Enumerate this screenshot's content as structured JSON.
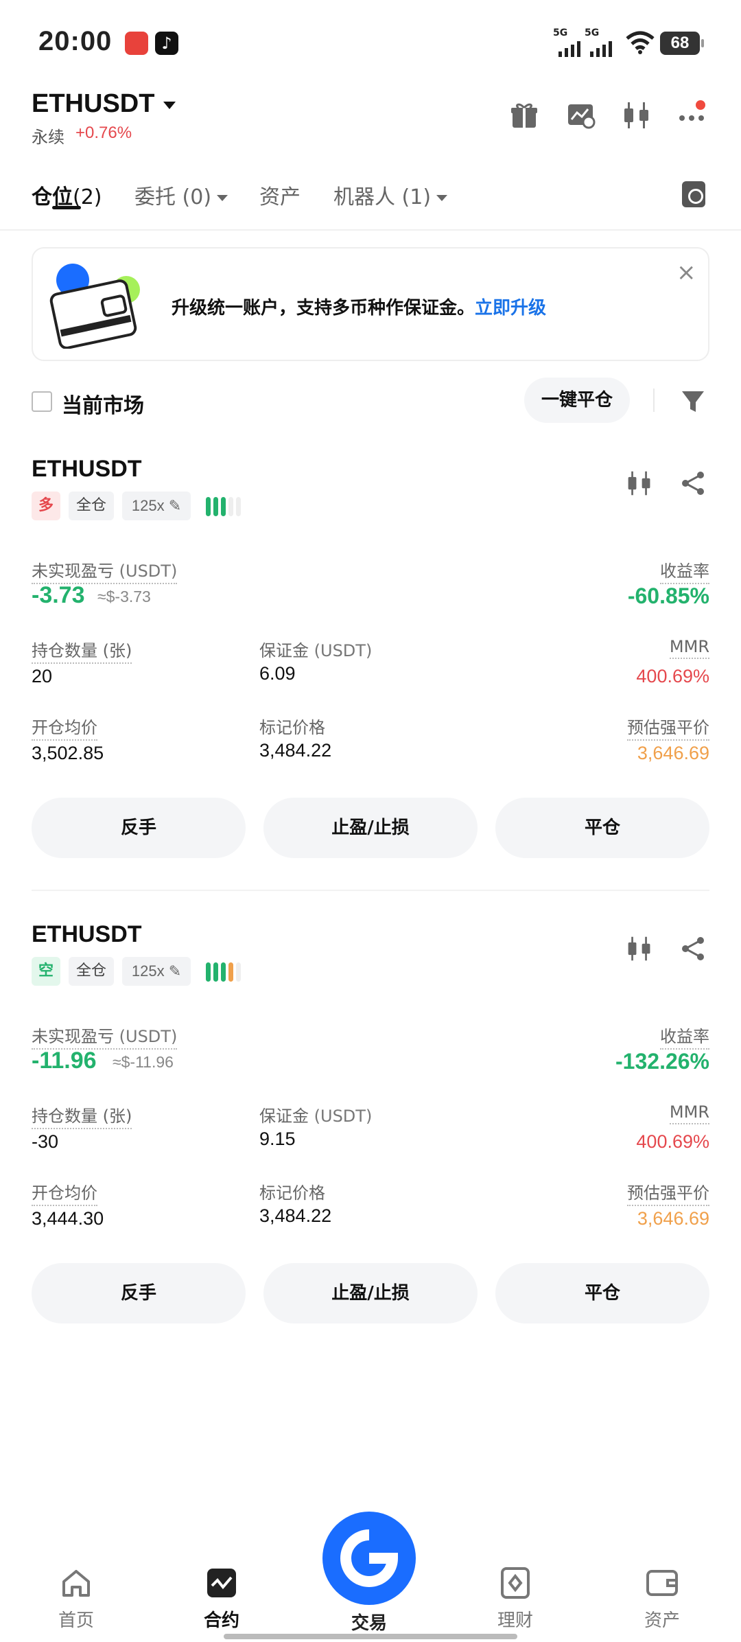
{
  "status_bar": {
    "time": "20:00",
    "net1": "5G",
    "net2": "5G",
    "battery": "68"
  },
  "header": {
    "symbol": "ETHUSDT",
    "type": "永续",
    "change": "+0.76%"
  },
  "tabs": [
    {
      "label": "仓位",
      "count": "(2)"
    },
    {
      "label": "委托",
      "count": "(0)"
    },
    {
      "label": "资产",
      "count": ""
    },
    {
      "label": "机器人",
      "count": "(1)"
    }
  ],
  "banner": {
    "text": "升级统一账户，支持多币种作保证金。",
    "link": "立即升级"
  },
  "filter": {
    "current_market": "当前市场",
    "close_all": "一键平仓"
  },
  "labels": {
    "unrealized_pnl": "未实现盈亏",
    "unit_usdt": "(USDT)",
    "roe": "收益率",
    "size": "持仓数量 (张)",
    "margin": "保证金",
    "mmr": "MMR",
    "entry_price": "开仓均价",
    "mark_price": "标记价格",
    "liq_price": "预估强平价",
    "btn_reverse": "反手",
    "btn_tpsl": "止盈/止损",
    "btn_close": "平仓"
  },
  "positions": [
    {
      "symbol": "ETHUSDT",
      "side": "多",
      "margin_mode": "全仓",
      "leverage": "125x",
      "adl_level": 3,
      "pnl": "-3.73",
      "pnl_approx": "≈$-3.73",
      "roe": "-60.85%",
      "size": "20",
      "margin": "6.09",
      "mmr": "400.69%",
      "entry_price": "3,502.85",
      "mark_price": "3,484.22",
      "liq_price": "3,646.69"
    },
    {
      "symbol": "ETHUSDT",
      "side": "空",
      "margin_mode": "全仓",
      "leverage": "125x",
      "adl_level": 4,
      "pnl": "-11.96",
      "pnl_approx": "≈$-11.96",
      "roe": "-132.26%",
      "size": "-30",
      "margin": "9.15",
      "mmr": "400.69%",
      "entry_price": "3,444.30",
      "mark_price": "3,484.22",
      "liq_price": "3,646.69"
    }
  ],
  "bottom_nav": {
    "home": "首页",
    "contract": "合约",
    "trade": "交易",
    "earn": "理财",
    "assets": "资产"
  },
  "colors": {
    "green": "#23b26d",
    "red": "#e5484d",
    "orange": "#f0a04b",
    "brand_blue": "#1a6dff",
    "link_blue": "#1a73e8"
  }
}
